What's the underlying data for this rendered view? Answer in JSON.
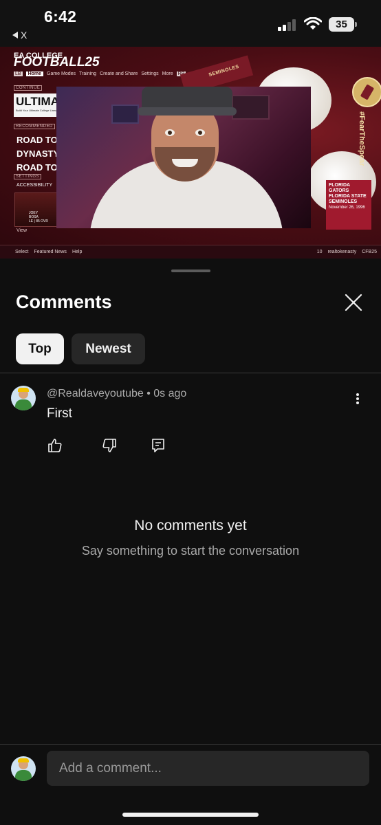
{
  "status_bar": {
    "time": "6:42",
    "back_app": "X",
    "battery": "35"
  },
  "video": {
    "logo_small": "EA COLLEGE",
    "logo_big": "FOOTBALL25",
    "nav": [
      "LB",
      "Home",
      "Game Modes",
      "Training",
      "Create and Share",
      "Settings",
      "More",
      "RB"
    ],
    "continue_label": "CONTINUE",
    "ultimate_title": "ULTIMA",
    "ultimate_sub": "Build Your Ultimate College Lineup",
    "recommended_label": "RECOMMENDED",
    "road_lines": [
      "ROAD TO T",
      "DYNASTY",
      "ROAD TO G"
    ],
    "settings_label": "SETTINGS",
    "accessibility": "ACCESSIBILITY",
    "player_name": "JOEY\nBOSA",
    "player_sub": "LE | 85 OVR",
    "view": "View",
    "pennant": "SEMINOLES",
    "hashtag": "#FearTheSpear",
    "ticket_team1": "FLORIDA GATORS",
    "ticket_team2": "FLORIDA STATE SEMINOLES",
    "ticket_date": "November 26, 1996",
    "bottom_left": [
      "Select",
      "Featured News",
      "Help"
    ],
    "bottom_right": [
      "10",
      "realtokenasty",
      "CFB25"
    ]
  },
  "comments_sheet": {
    "title": "Comments",
    "filters": [
      "Top",
      "Newest"
    ],
    "comment": {
      "author": "@Realdaveyoutube",
      "time": "0s ago",
      "text": "First"
    },
    "empty_title": "No comments yet",
    "empty_subtitle": "Say something to start the conversation",
    "input_placeholder": "Add a comment..."
  }
}
